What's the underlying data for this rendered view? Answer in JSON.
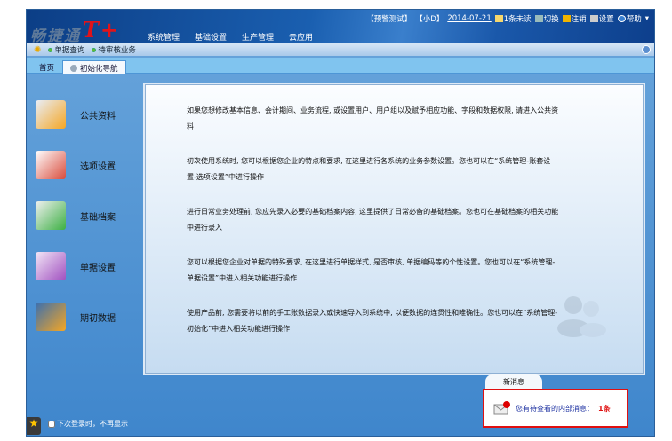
{
  "app": {
    "logo_text": "畅捷通",
    "logo_mark": "T+"
  },
  "nav": [
    "系统管理",
    "基础设置",
    "生产管理",
    "云应用"
  ],
  "top_right": {
    "account": "【预警测试】",
    "user": "【小D】",
    "date": "2014-07-21",
    "unread": "1条未读",
    "switch": "切换",
    "logout": "注销",
    "settings": "设置",
    "help": "帮助"
  },
  "toolbar": {
    "items": [
      "单据查询",
      "待审核业务"
    ]
  },
  "tabs": {
    "home": "首页",
    "active": "初始化导航"
  },
  "left_items": [
    "公共资料",
    "选项设置",
    "基础档案",
    "单据设置",
    "期初数据"
  ],
  "paragraphs": [
    "如果您想修改基本信息、会计期间、业务流程, 或设置用户、用户组以及赋予相应功能、字段和数据权限, 请进入公共资料",
    "初次使用系统时, 您可以根据您企业的特点和要求, 在这里进行各系统的业务参数设置。您也可以在“系统管理-账套设置-选项设置”中进行操作",
    "进行日常业务处理前, 您应先录入必要的基础档案内容, 这里提供了日常必备的基础档案。您也可在基础档案的相关功能中进行录入",
    "您可以根据您企业对单据的特殊要求, 在这里进行单据样式, 是否审核, 单据编码等的个性设置。您也可以在“系统管理-单据设置”中进入相关功能进行操作",
    "使用产品前, 您需要将以前的手工账数据录入或快速导入到系统中, 以便数据的连贯性和唯确性。您也可以在“系统管理-初始化”中进入相关功能进行操作"
  ],
  "message": {
    "tab": "新消息",
    "text": "您有待查看的内部消息：",
    "count": "1条"
  },
  "footer": {
    "no_show": "下次登录时，不再显示"
  },
  "colors": {
    "header": "#0c3e86",
    "accent_red": "#e01010",
    "link_blue": "#1b2fa0"
  }
}
